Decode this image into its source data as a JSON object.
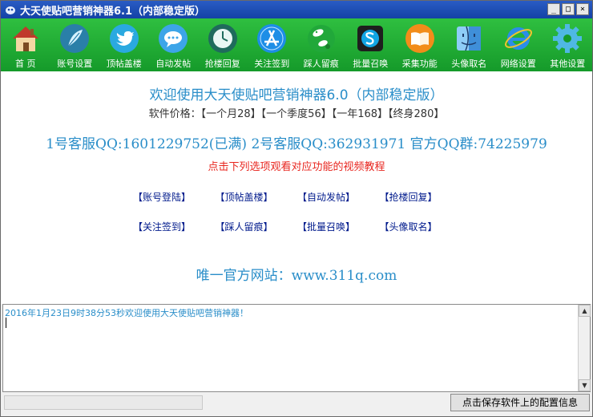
{
  "window": {
    "title": "大天使贴吧营销神器6.1（内部稳定版）",
    "minimize": "_",
    "maximize": "□",
    "close": "×"
  },
  "toolbar": [
    {
      "label": "首 页",
      "icon": "home-icon"
    },
    {
      "label": "账号设置",
      "icon": "feather-icon"
    },
    {
      "label": "顶帖盖楼",
      "icon": "twitter-bird-icon"
    },
    {
      "label": "自动发帖",
      "icon": "chat-bubble-icon"
    },
    {
      "label": "抢楼回复",
      "icon": "clock-icon"
    },
    {
      "label": "关注签到",
      "icon": "app-store-icon"
    },
    {
      "label": "踩人留痕",
      "icon": "footprint-icon"
    },
    {
      "label": "批量召唤",
      "icon": "skype-icon"
    },
    {
      "label": "采集功能",
      "icon": "book-icon"
    },
    {
      "label": "头像取名",
      "icon": "finder-face-icon"
    },
    {
      "label": "网络设置",
      "icon": "ie-browser-icon"
    },
    {
      "label": "其他设置",
      "icon": "gear-icon"
    }
  ],
  "main": {
    "headline": "欢迎使用大天使贴吧营销神器6.0（内部稳定版）",
    "price": "软件价格：【一个月28】【一个季度56】【一年168】【终身280】",
    "contacts": "1号客服QQ:1601229752(已满)   2号客服QQ:362931971  官方QQ群:74225979",
    "notice": "点击下列选项观看对应功能的视频教程",
    "links_row1": [
      "【账号登陆】",
      "【顶帖盖楼】",
      "【自动发帖】",
      "【抢楼回复】"
    ],
    "links_row2": [
      "【关注签到】",
      "【踩人留痕】",
      "【批量召唤】",
      "【头像取名】"
    ],
    "site": "唯一官方网站：www.311q.com"
  },
  "log": {
    "line": "2016年1月23日9时38分53秒欢迎使用大天使贴吧营销神器！",
    "scroll_up": "▲",
    "scroll_down": "▼"
  },
  "status": {
    "save_button": "点击保存软件上的配置信息"
  },
  "colors": {
    "title_bar": "#1442a6",
    "toolbar_green": "#159a2a",
    "accent_blue": "#2a8ec9",
    "notice_red": "#e8261f",
    "link_navy": "#001a8c"
  }
}
